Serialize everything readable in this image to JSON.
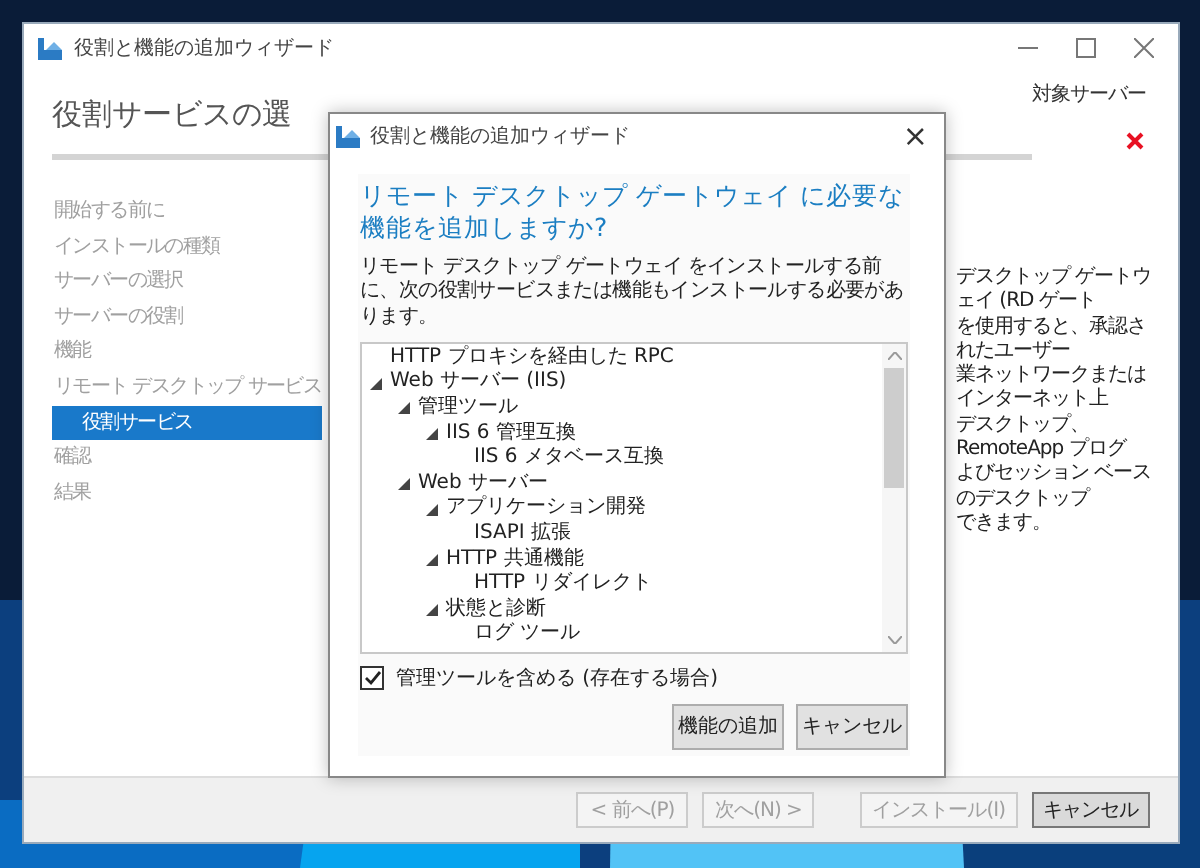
{
  "window": {
    "title": "役割と機能の追加ウィザード"
  },
  "page": {
    "heading": "役割サービスの選",
    "target_server": "対象サーバー"
  },
  "sidebar": {
    "items": [
      {
        "label": "開始する前に",
        "selected": false
      },
      {
        "label": "インストールの種類",
        "selected": false
      },
      {
        "label": "サーバーの選択",
        "selected": false
      },
      {
        "label": "サーバーの役割",
        "selected": false
      },
      {
        "label": "機能",
        "selected": false
      },
      {
        "label": "リモート デスクトップ サービス",
        "selected": false,
        "children": [
          {
            "label": "役割サービス",
            "selected": true
          }
        ]
      },
      {
        "label": "確認",
        "selected": false
      },
      {
        "label": "結果",
        "selected": false
      }
    ]
  },
  "description_lines": [
    "デスクトップ ゲートウェイ (RD ゲート",
    "を使用すると、承認されたユーザー",
    "業ネットワークまたはインターネット上",
    "デスクトップ、RemoteApp プログ",
    "よびセッション ベースのデスクトップ",
    "できます。"
  ],
  "buttons": [
    {
      "label": "< 前へ(P)",
      "disabled": true,
      "focused": false
    },
    {
      "label": "次へ(N) >",
      "disabled": true,
      "focused": false
    },
    {
      "label": "インストール(I)",
      "disabled": true,
      "focused": false
    },
    {
      "label": "キャンセル",
      "disabled": false,
      "focused": true
    }
  ],
  "dialog": {
    "title": "役割と機能の追加ウィザード",
    "close": "×",
    "heading": "リモート デスクトップ ゲートウェイ に必要な機能を追加しますか?",
    "description": "リモート デスクトップ ゲートウェイ をインストールする前に、次の役割サービスまたは機能もインストールする必要があります。",
    "tree": [
      {
        "label": "HTTP プロキシを経由した RPC"
      },
      {
        "label": "Web サーバー (IIS)",
        "expanded": true,
        "children": [
          {
            "label": "管理ツール",
            "expanded": true,
            "children": [
              {
                "label": "IIS 6 管理互換",
                "expanded": true,
                "children": [
                  {
                    "label": "IIS 6 メタベース互換"
                  }
                ]
              }
            ]
          },
          {
            "label": "Web サーバー",
            "expanded": true,
            "children": [
              {
                "label": "アプリケーション開発",
                "expanded": true,
                "children": [
                  {
                    "label": "ISAPI 拡張"
                  }
                ]
              },
              {
                "label": "HTTP 共通機能",
                "expanded": true,
                "children": [
                  {
                    "label": "HTTP リダイレクト"
                  }
                ]
              },
              {
                "label": "状態と診断",
                "expanded": true,
                "children": [
                  {
                    "label": "ログ ツール"
                  }
                ]
              }
            ]
          }
        ]
      }
    ],
    "include_tools": {
      "label": "管理ツールを含める (存在する場合)",
      "checked": true
    },
    "buttons": [
      {
        "label": "機能の追加"
      },
      {
        "label": "キャンセル"
      }
    ]
  }
}
